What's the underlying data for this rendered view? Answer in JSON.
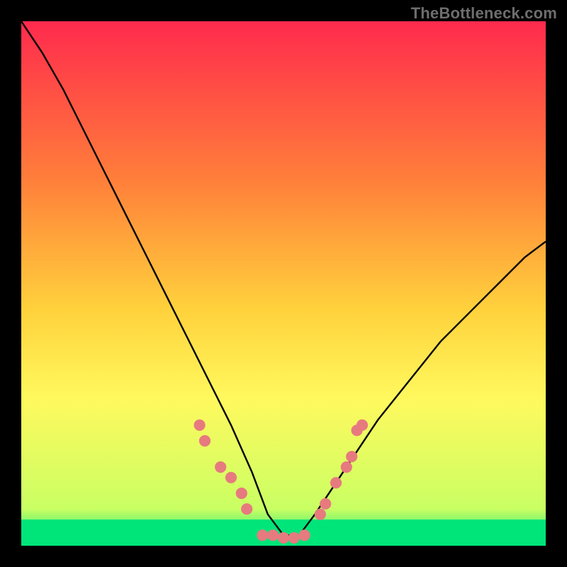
{
  "watermark": "TheBottleneck.com",
  "chart_data": {
    "type": "line",
    "title": "",
    "xlabel": "",
    "ylabel": "",
    "xlim": [
      0,
      100
    ],
    "ylim": [
      0,
      100
    ],
    "grid": false,
    "legend": false,
    "background": {
      "type": "vertical-gradient",
      "stops": [
        {
          "offset": 0,
          "color": "#ff2a4d"
        },
        {
          "offset": 30,
          "color": "#ff7e3a"
        },
        {
          "offset": 55,
          "color": "#ffd23c"
        },
        {
          "offset": 72,
          "color": "#fff95e"
        },
        {
          "offset": 93,
          "color": "#c9ff63"
        },
        {
          "offset": 100,
          "color": "#00e57a"
        }
      ]
    },
    "bottom_band": {
      "y_from": 0,
      "y_to": 5,
      "color": "#00e57a"
    },
    "series": [
      {
        "name": "bottleneck-curve",
        "color": "#000000",
        "x": [
          0,
          4,
          8,
          12,
          16,
          20,
          24,
          28,
          32,
          36,
          40,
          44,
          47,
          50,
          53,
          56,
          60,
          64,
          68,
          72,
          76,
          80,
          84,
          88,
          92,
          96,
          100
        ],
        "y": [
          100,
          94,
          87,
          79,
          71,
          63,
          55,
          47,
          39,
          31,
          23,
          14,
          6,
          2,
          2,
          6,
          12,
          18,
          24,
          29,
          34,
          39,
          43,
          47,
          51,
          55,
          58
        ]
      }
    ],
    "markers": {
      "color": "#e77a7f",
      "radius_pct": 1.1,
      "points": [
        {
          "x": 34,
          "y": 23
        },
        {
          "x": 35,
          "y": 20
        },
        {
          "x": 38,
          "y": 15
        },
        {
          "x": 40,
          "y": 13
        },
        {
          "x": 42,
          "y": 10
        },
        {
          "x": 43,
          "y": 7
        },
        {
          "x": 46,
          "y": 2
        },
        {
          "x": 48,
          "y": 2
        },
        {
          "x": 50,
          "y": 1.5
        },
        {
          "x": 52,
          "y": 1.5
        },
        {
          "x": 54,
          "y": 2
        },
        {
          "x": 57,
          "y": 6
        },
        {
          "x": 58,
          "y": 8
        },
        {
          "x": 60,
          "y": 12
        },
        {
          "x": 62,
          "y": 15
        },
        {
          "x": 63,
          "y": 17
        },
        {
          "x": 64,
          "y": 22
        },
        {
          "x": 65,
          "y": 23
        }
      ]
    }
  }
}
